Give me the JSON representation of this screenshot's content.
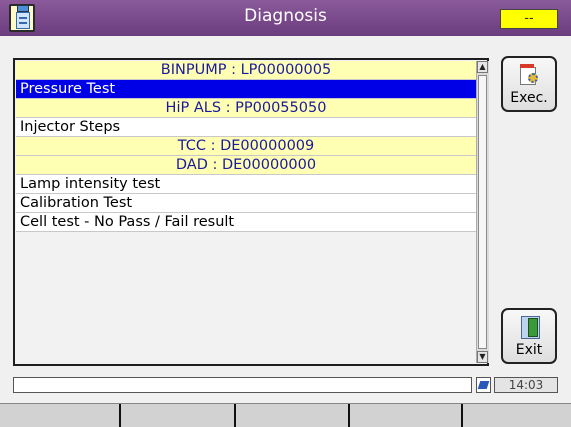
{
  "window": {
    "title": "Diagnosis",
    "status_chip": "--"
  },
  "tests": [
    {
      "text": "BINPUMP : LP00000005",
      "kind": "group"
    },
    {
      "text": "Pressure Test",
      "kind": "selected"
    },
    {
      "text": "HiP ALS : PP00055050",
      "kind": "group"
    },
    {
      "text": "Injector Steps",
      "kind": "item"
    },
    {
      "text": "TCC : DE00000009",
      "kind": "group"
    },
    {
      "text": "DAD : DE00000000",
      "kind": "group"
    },
    {
      "text": "Lamp intensity test",
      "kind": "item"
    },
    {
      "text": "Calibration Test",
      "kind": "item"
    },
    {
      "text": "Cell test - No Pass / Fail result",
      "kind": "item"
    }
  ],
  "buttons": {
    "exec": "Exec.",
    "exit": "Exit"
  },
  "status": {
    "message": "",
    "time": "14:03"
  },
  "softkeys": [
    "",
    "",
    "",
    "",
    ""
  ],
  "icons": {
    "app": "clipboard-icon",
    "exec": "execute-icon",
    "exit": "exit-door-icon",
    "network": "network-icon"
  },
  "colors": {
    "titlebar": "#6b3c7e",
    "selection": "#0000e6",
    "group_row": "#ffffb4",
    "status_chip": "#ffff00"
  }
}
